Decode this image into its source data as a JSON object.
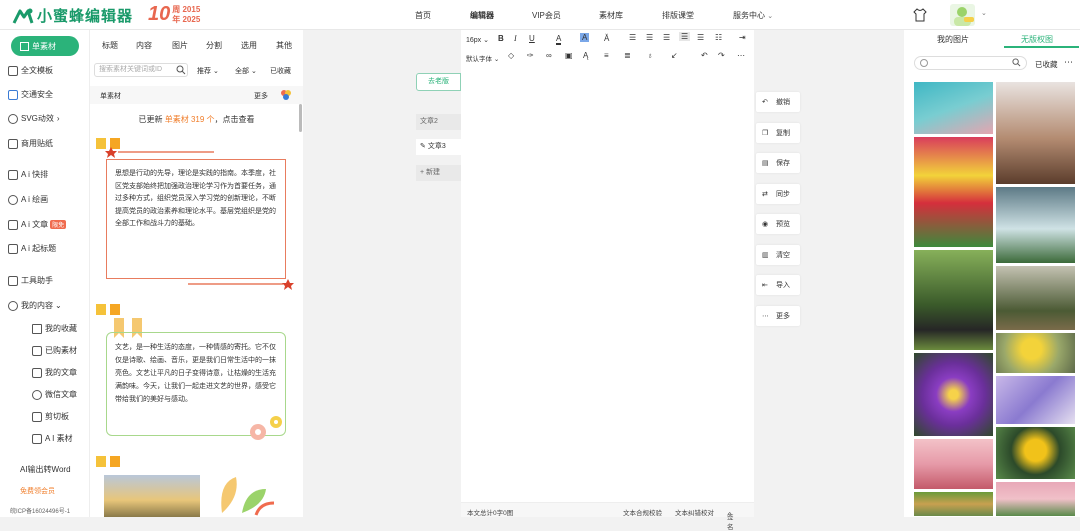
{
  "brand": {
    "name": "小蜜蜂编辑器",
    "ten": "10",
    "years_top": "周 2015",
    "years_bottom": "年 2025"
  },
  "nav": {
    "items": [
      "首页",
      "编辑器",
      "VIP会员",
      "素材库",
      "排版课堂",
      "服务中心"
    ]
  },
  "sidebar": {
    "primary": "单素材",
    "items": [
      {
        "label": "全文模板"
      },
      {
        "label": "交通安全"
      },
      {
        "label": "SVG动效"
      },
      {
        "label": "商用贴纸"
      },
      {
        "label": "A i 快排"
      },
      {
        "label": "A i 绘画"
      },
      {
        "label": "A i 文章",
        "badge": "限免"
      },
      {
        "label": "A i 起标题"
      },
      {
        "label": "工具助手"
      },
      {
        "label": "我的内容"
      }
    ],
    "sub": [
      "我的收藏",
      "已购素材",
      "我的文章",
      "微信文章",
      "剪切板",
      "A I 素材"
    ],
    "word": "AI输出转Word",
    "vip": "免费领会员",
    "icp": "皖ICP备16024496号-1"
  },
  "materials": {
    "tabs": [
      "标题",
      "内容",
      "图片",
      "分割",
      "选用",
      "其他"
    ],
    "search_placeholder": "搜索素材关键词或ID",
    "filters": [
      "推荐",
      "全部",
      "已收藏"
    ],
    "head_left": "单素材",
    "head_right": "更多",
    "updated_prefix": "已更新",
    "updated_hl": "单素材 319 个",
    "updated_suffix": "，点击查看",
    "card1_text": "思想是行动的先导，理论是实践的指南。本季度，社区党支部始终把加强政治理论学习作为首要任务，通过多种方式，组织党员深入学习党的创新理论，不断提高党员的政治素养和理论水平。基层党组织是党的全部工作和战斗力的基础。",
    "card2_text": "文艺，是一种生活的态度，一种情感的寄托。它不仅仅是诗歌、绘画、音乐，更是我们日常生活中的一抹亮色。文艺让平凡的日子变得诗意，让枯燥的生活充满韵味。今天，让我们一起走进文艺的世界，感受它带给我们的美好与感动。"
  },
  "articles": {
    "old": "去老版",
    "items": [
      "文章2",
      "文章3",
      "新建"
    ]
  },
  "toolbar": {
    "fontsize": "16px",
    "fontfamily": "默认字体"
  },
  "footer": {
    "count": "本文总计0字0图",
    "check": "文本合规校验",
    "correct": "文本纠错校对",
    "sign": "签名"
  },
  "actions": [
    "撤销",
    "复制",
    "保存",
    "同步",
    "预览",
    "清空",
    "导入",
    "更多"
  ],
  "right": {
    "tabs": [
      "我的图片",
      "无版权图"
    ],
    "fav": "已收藏"
  },
  "colors": {
    "brand": "#2bb37a",
    "accent": "#f07c28"
  }
}
